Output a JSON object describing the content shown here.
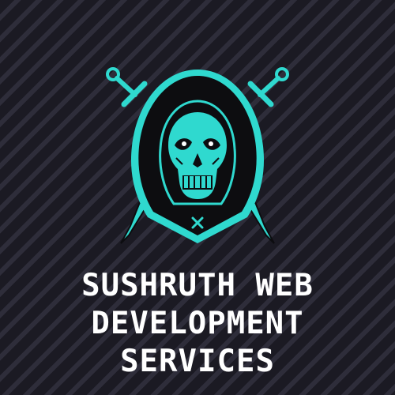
{
  "brand": {
    "lines": [
      "SUSHRUTH WEB",
      "DEVELOPMENT",
      "SERVICES"
    ]
  },
  "colors": {
    "background": "#1c1b24",
    "stripe": "#2e2d3a",
    "accent": "#2fd9cf",
    "hood": "#0d0d10",
    "text": "#ffffff"
  },
  "icons": {
    "emblem": "hooded-skull-with-crossed-swords"
  }
}
